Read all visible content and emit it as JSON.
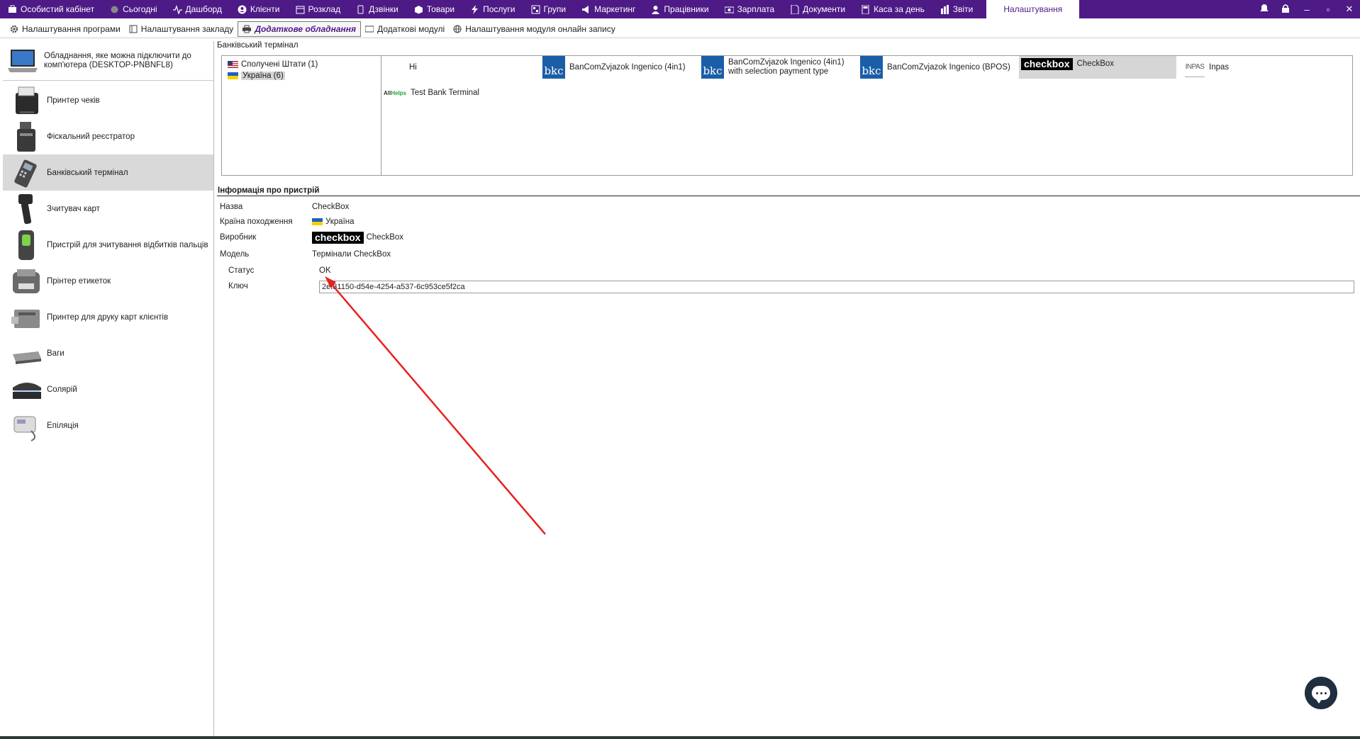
{
  "topnav": {
    "items": [
      {
        "label": "Особистий кабінет",
        "icon": "cabinet-icon"
      },
      {
        "label": "Сьогодні",
        "icon": "today-icon"
      },
      {
        "label": "Дашборд",
        "icon": "pulse-icon"
      },
      {
        "label": "Клієнти",
        "icon": "user-circle-icon"
      },
      {
        "label": "Розклад",
        "icon": "calendar-icon"
      },
      {
        "label": "Дзвінки",
        "icon": "phone-icon"
      },
      {
        "label": "Товари",
        "icon": "box-icon"
      },
      {
        "label": "Послуги",
        "icon": "lightning-icon"
      },
      {
        "label": "Групи",
        "icon": "groups-icon"
      },
      {
        "label": "Маркетинг",
        "icon": "megaphone-icon"
      },
      {
        "label": "Працівники",
        "icon": "person-icon"
      },
      {
        "label": "Зарплата",
        "icon": "money-icon"
      },
      {
        "label": "Документи",
        "icon": "document-icon"
      },
      {
        "label": "Каса за день",
        "icon": "calculator-icon"
      },
      {
        "label": "Звіти",
        "icon": "bar-chart-icon"
      }
    ],
    "active_label": "Налаштування",
    "window_controls": {
      "minimize": "–",
      "restore": "▫",
      "close": "✕"
    }
  },
  "subnav": {
    "tabs": [
      {
        "label": "Налаштування програми",
        "icon": "gear-icon"
      },
      {
        "label": "Налаштування закладу",
        "icon": "building-icon"
      },
      {
        "label": "Додаткове обладнання",
        "icon": "printer-icon",
        "active": true
      },
      {
        "label": "Додаткові модулі",
        "icon": "modules-icon"
      },
      {
        "label": "Налаштування модуля онлайн запису",
        "icon": "globe-icon"
      }
    ]
  },
  "left": {
    "connected_label": "Обладнання, яке можна підключити до комп'ютера (DESKTOP-PNBNFL8)",
    "devices": [
      {
        "label": "Принтер чеків",
        "icon": "receipt-printer-icon"
      },
      {
        "label": "Фіскальний реєстратор",
        "icon": "fiscal-registrar-icon"
      },
      {
        "label": "Банківський термінал",
        "icon": "bank-terminal-icon",
        "selected": true
      },
      {
        "label": "Зчитувач карт",
        "icon": "card-reader-icon"
      },
      {
        "label": "Пристрій для зчитування відбитків пальців",
        "icon": "fingerprint-reader-icon"
      },
      {
        "label": "Прінтер етикеток",
        "icon": "label-printer-icon"
      },
      {
        "label": "Принтер для друку карт клієнтів",
        "icon": "card-printer-icon"
      },
      {
        "label": "Ваги",
        "icon": "scales-icon"
      },
      {
        "label": "Солярій",
        "icon": "solarium-icon"
      },
      {
        "label": "Епіляція",
        "icon": "epilation-icon"
      }
    ]
  },
  "main": {
    "section_title": "Банківський термінал",
    "countries": [
      {
        "label": "Сполучені Штати (1)",
        "flag": "us-flag"
      },
      {
        "label": "Україна (6)",
        "flag": "ua-flag",
        "selected": true
      }
    ],
    "terminals": {
      "hi": "Hi",
      "bkc_logo": "bkc",
      "bkc1": "BanComZvjazok Ingenico (4in1)",
      "bkc2": "BanComZvjazok Ingenico (4in1) with selection payment type",
      "bkc3": "BanComZvjazok Ingenico (BPOS)",
      "checkbox_logo": "checkbox",
      "checkbox": "CheckBox",
      "inpas_logo": "INPAS",
      "inpas": "Inpas",
      "allhelps_logo_a": "All",
      "allhelps_logo_b": "Helps",
      "test": "Test Bank Terminal"
    },
    "info": {
      "title": "Інформація про пристрій",
      "name_label": "Назва",
      "name": "CheckBox",
      "country_label": "Країна походження",
      "country": "Україна",
      "maker_label": "Виробник",
      "maker_logo": "checkbox",
      "maker": "CheckBox",
      "model_label": "Модель",
      "model": "Термінали CheckBox",
      "status_label": "Статус",
      "status": "OK",
      "key_label": "Ключ",
      "key": "2ef31150-d54e-4254-a537-6c953ce5f2ca"
    }
  },
  "colors": {
    "nav": "#4d1a86",
    "selected": "#d9d9d9",
    "ok": "#2e9e2e",
    "arrow": "#e8201f",
    "bkc": "#1a5ea8"
  }
}
